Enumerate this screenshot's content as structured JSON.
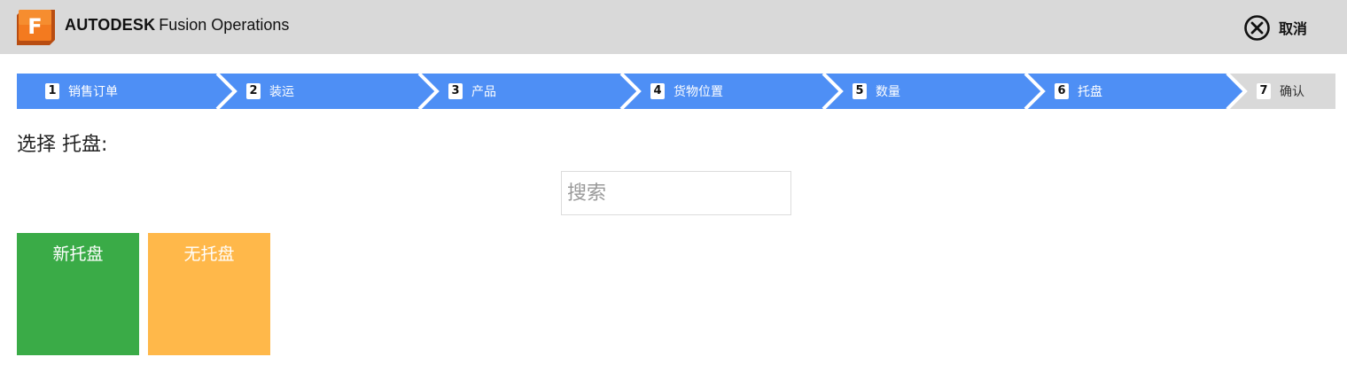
{
  "header": {
    "brand": "AUTODESK",
    "product": "Fusion Operations",
    "logo_letter": "F",
    "cancel_label": "取消"
  },
  "steps": [
    {
      "num": "1",
      "label": "销售订单",
      "active": true
    },
    {
      "num": "2",
      "label": "装运",
      "active": true
    },
    {
      "num": "3",
      "label": "产品",
      "active": true
    },
    {
      "num": "4",
      "label": "货物位置",
      "active": true
    },
    {
      "num": "5",
      "label": "数量",
      "active": true
    },
    {
      "num": "6",
      "label": "托盘",
      "active": true
    },
    {
      "num": "7",
      "label": "确认",
      "active": false
    }
  ],
  "main": {
    "title": "选择 托盘:",
    "search_placeholder": "搜索",
    "tiles": [
      {
        "label": "新托盘",
        "color": "#3aab47"
      },
      {
        "label": "无托盘",
        "color": "#ffb84a"
      }
    ]
  },
  "colors": {
    "header_bg": "#d9d9d9",
    "step_active": "#4e8ff5",
    "step_inactive": "#d9d9d9",
    "logo_orange": "#f37021"
  }
}
